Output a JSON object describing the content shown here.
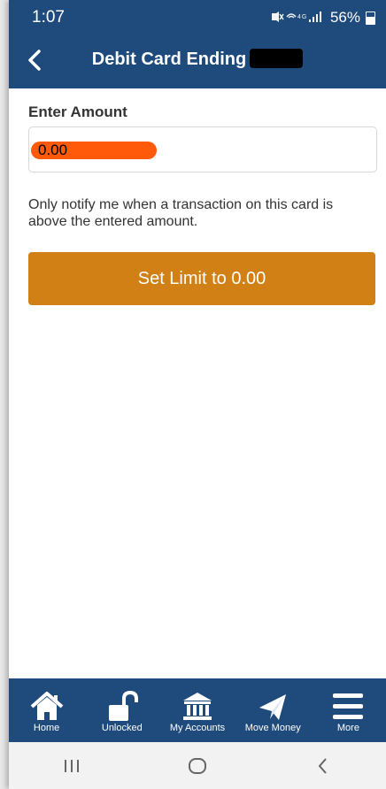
{
  "status": {
    "time": "1:07",
    "signal_icons": "✶ ̸ 4G ❙",
    "battery": "56%"
  },
  "header": {
    "title": "Debit Card Ending"
  },
  "form": {
    "label": "Enter Amount",
    "amount_value": "0.00",
    "note": "Only notify me when a transaction on this card is above the entered amount.",
    "button_label": "Set Limit to 0.00"
  },
  "tabbar": {
    "items": [
      {
        "label": "Home",
        "icon": "home-icon"
      },
      {
        "label": "Unlocked",
        "icon": "unlocked-icon"
      },
      {
        "label": "My Accounts",
        "icon": "bank-icon"
      },
      {
        "label": "Move Money",
        "icon": "send-icon"
      },
      {
        "label": "More",
        "icon": "menu-icon"
      }
    ]
  },
  "colors": {
    "header_blue": "#1e4a7c",
    "button_orange": "#d08014",
    "highlight": "#ff5a0a"
  }
}
